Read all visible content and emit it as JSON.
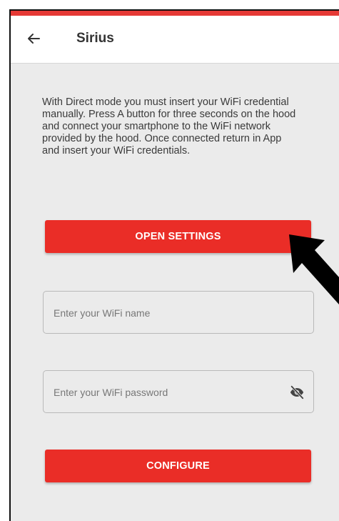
{
  "header": {
    "title": "Sirius",
    "back_icon": "arrow-left-icon"
  },
  "intro": {
    "text": "With Direct mode you must insert your WiFi credential manually. Press A button for three seconds on the hood and connect your smartphone to the WiFi network provided by the hood. Once connected return in App and insert your WiFi credentials."
  },
  "buttons": {
    "open_settings": "OPEN SETTINGS",
    "configure": "CONFIGURE"
  },
  "fields": {
    "wifi_name": {
      "placeholder": "Enter your WiFi name",
      "value": ""
    },
    "wifi_password": {
      "placeholder": "Enter your WiFi password",
      "value": "",
      "toggle_icon": "eye-off-icon"
    }
  },
  "colors": {
    "accent": "#ea2d27",
    "background": "#ebebeb",
    "header": "#ffffff"
  }
}
